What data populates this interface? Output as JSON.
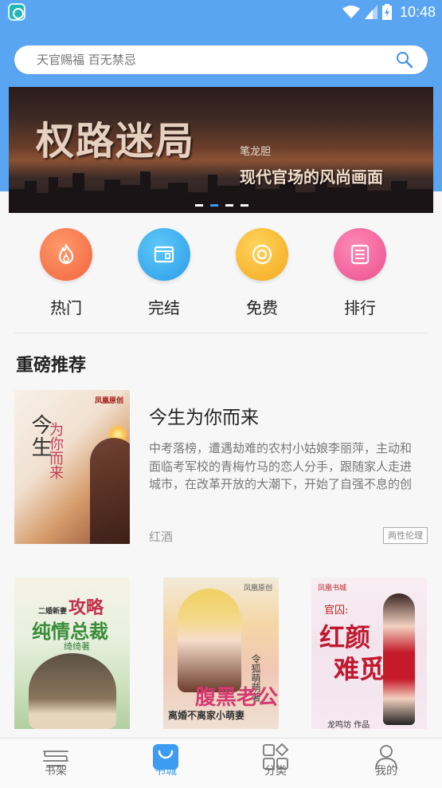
{
  "status_bar": {
    "time": "10:48"
  },
  "search": {
    "placeholder": "天官赐福 百无禁忌",
    "icon": "search-icon"
  },
  "banner": {
    "title": "权路迷局",
    "author": "笔龙胆",
    "subtitle": "现代官场的风尚画面",
    "slide_count": 4,
    "active_slide": 2
  },
  "categories": [
    {
      "label": "热门",
      "icon": "fire-icon",
      "color": "#f2633f"
    },
    {
      "label": "完结",
      "icon": "book-icon",
      "color": "#2a9ce8"
    },
    {
      "label": "免费",
      "icon": "coin-icon",
      "color": "#f4a81c"
    },
    {
      "label": "排行",
      "icon": "list-icon",
      "color": "#ea4f8e"
    }
  ],
  "section": {
    "title": "重磅推荐"
  },
  "featured": {
    "cover": {
      "publisher": "凤凰原创",
      "title": "今生",
      "subtitle": "为你而来"
    },
    "title": "今生为你而来",
    "description": "中考落榜，遭遇劫难的农村小姑娘李丽萍，主动和面临考军校的青梅竹马的恋人分手，跟随家人走进城市，在改革开放的大潮下，开始了自强不息的创业之路。商海的沉浮，情感的...",
    "author": "红酒",
    "tag": "两性伦理"
  },
  "grid_books": [
    {
      "line1": "二婚新妻",
      "line2": "攻略",
      "line3": "纯情总裁",
      "author": "绮绮著"
    },
    {
      "publisher": "凤凰原创",
      "author": "令狐萌萌著",
      "line1": "腹黑老公",
      "line2": "离婚不离家小萌妻"
    },
    {
      "publisher": "凤凰书城",
      "line0": "官囚:",
      "line1": "红颜",
      "line2": "难觅",
      "author": "龙鸣坊 作品"
    }
  ],
  "bottom_nav": [
    {
      "label": "书架",
      "icon": "bookshelf-icon",
      "active": false
    },
    {
      "label": "书城",
      "icon": "bookstore-icon",
      "active": true
    },
    {
      "label": "分类",
      "icon": "category-icon",
      "active": false
    },
    {
      "label": "我的",
      "icon": "profile-icon",
      "active": false
    }
  ],
  "colors": {
    "primary": "#5aa5f2",
    "accent": "#3b9cf0"
  }
}
